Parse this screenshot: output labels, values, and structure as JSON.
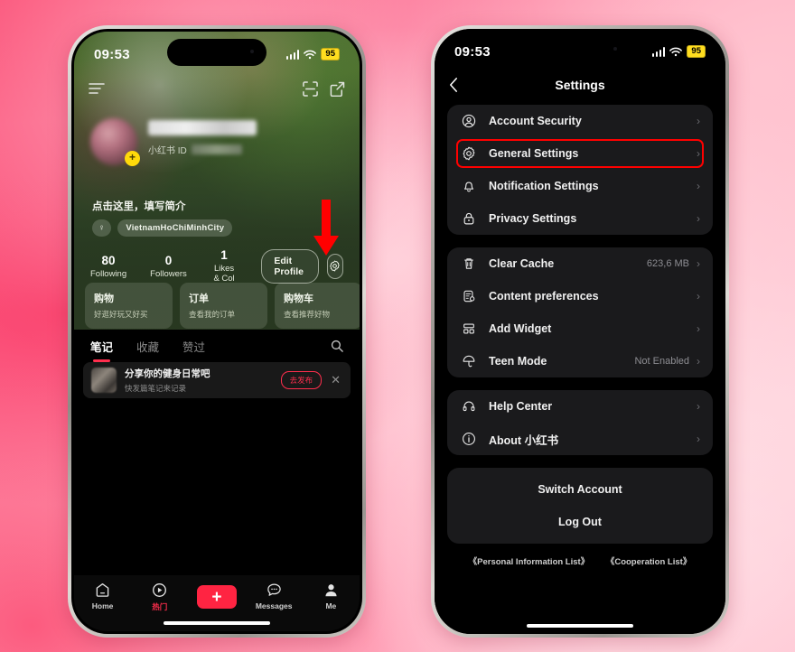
{
  "background": {
    "accent_pink": "#fb4a72",
    "light_pink": "#ffd3dd"
  },
  "left_phone": {
    "status_bar": {
      "time": "09:53",
      "battery": "95",
      "signal_icon": "cellular-bars-icon",
      "wifi_icon": "wifi-icon"
    },
    "header": {
      "menu_icon": "hamburger-menu-icon",
      "scan_icon": "qr-scan-icon",
      "share_icon": "share-icon"
    },
    "profile": {
      "avatar_badge": "+",
      "user_id_label": "小红书 ID",
      "bio_prompt": "点击这里，填写简介",
      "gender_tag": "♀",
      "location_tag": "VietnamHoChiMinhCity",
      "edit_profile_label": "Edit Profile",
      "settings_icon": "gear-icon",
      "stats": [
        {
          "num": "80",
          "label": "Following"
        },
        {
          "num": "0",
          "label": "Followers"
        },
        {
          "num": "1",
          "label": "Likes & Col"
        }
      ],
      "service_cards": [
        {
          "title": "购物",
          "subtitle": "好逛好玩又好买"
        },
        {
          "title": "订单",
          "subtitle": "查看我的订单"
        },
        {
          "title": "购物车",
          "subtitle": "查看推荐好物"
        }
      ]
    },
    "content_tabs": [
      {
        "label": "笔记",
        "active": true
      },
      {
        "label": "收藏",
        "active": false
      },
      {
        "label": "赞过",
        "active": false
      }
    ],
    "search_icon": "search-icon",
    "promo": {
      "title": "分享你的健身日常吧",
      "subtitle": "快发篇笔记来记录",
      "button": "去发布",
      "close_icon": "close-icon"
    },
    "tabbar": [
      {
        "label": "Home",
        "icon": "home-icon",
        "hot": false
      },
      {
        "label": "热门",
        "icon": "play-icon",
        "hot": true
      },
      {
        "label": "",
        "icon": "plus-icon",
        "hot": false
      },
      {
        "label": "Messages",
        "icon": "message-icon",
        "hot": false
      },
      {
        "label": "Me",
        "icon": "person-icon",
        "hot": false
      }
    ]
  },
  "right_phone": {
    "status_bar": {
      "time": "09:53",
      "battery": "95",
      "signal_icon": "cellular-bars-icon",
      "wifi_icon": "wifi-icon"
    },
    "nav": {
      "title": "Settings",
      "back_icon": "chevron-left-icon"
    },
    "highlight_color": "#ff0000",
    "group1": [
      {
        "label": "Account Security",
        "icon": "person-circle-icon",
        "value": "",
        "highlighted": false
      },
      {
        "label": "General Settings",
        "icon": "gear-icon",
        "value": "",
        "highlighted": true
      },
      {
        "label": "Notification Settings",
        "icon": "bell-icon",
        "value": "",
        "highlighted": false
      },
      {
        "label": "Privacy Settings",
        "icon": "lock-icon",
        "value": "",
        "highlighted": false
      }
    ],
    "group2": [
      {
        "label": "Clear Cache",
        "icon": "trash-icon",
        "value": "623,6 MB"
      },
      {
        "label": "Content preferences",
        "icon": "document-icon",
        "value": ""
      },
      {
        "label": "Add Widget",
        "icon": "widget-icon",
        "value": ""
      },
      {
        "label": "Teen Mode",
        "icon": "umbrella-icon",
        "value": "Not Enabled"
      }
    ],
    "group3": [
      {
        "label": "Help Center",
        "icon": "headset-icon",
        "value": ""
      },
      {
        "label": "About 小红书",
        "icon": "info-icon",
        "value": ""
      }
    ],
    "account_actions": [
      {
        "label": "Switch Account"
      },
      {
        "label": "Log Out"
      }
    ],
    "legal": {
      "personal_info": "《Personal Information List》",
      "cooperation": "《Cooperation List》"
    }
  }
}
